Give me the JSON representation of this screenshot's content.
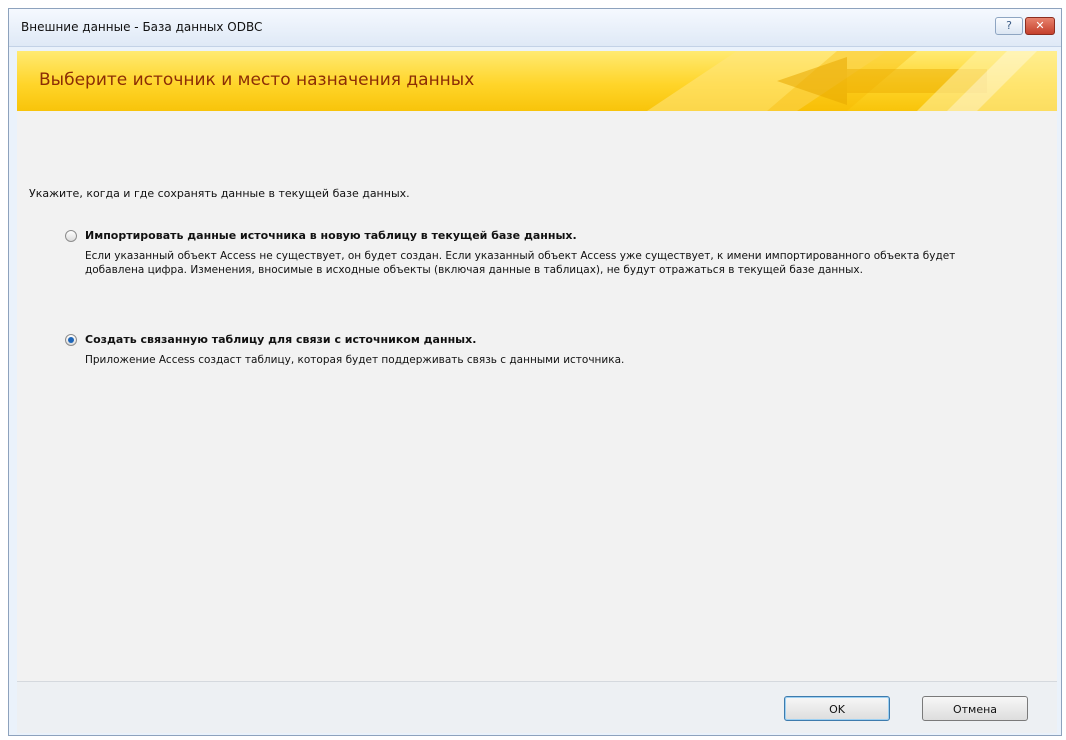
{
  "window": {
    "title": "Внешние данные - База данных ODBC",
    "help_symbol": "?",
    "close_symbol": "✕"
  },
  "banner": {
    "heading": "Выберите источник и место назначения данных",
    "colors": {
      "base": "#ffd52a",
      "heading": "#8c2d05"
    }
  },
  "main": {
    "instruction": "Укажите, когда и где сохранять данные в текущей базе данных.",
    "options": [
      {
        "label": "Импортировать данные источника в новую таблицу в текущей базе данных.",
        "description": "Если указанный объект Access не существует, он будет создан. Если указанный объект Access уже существует, к имени импортированного объекта будет добавлена цифра. Изменения, вносимые в исходные объекты (включая данные в таблицах), не будут отражаться в текущей базе данных.",
        "selected": false
      },
      {
        "label": "Создать связанную таблицу для связи с источником данных.",
        "description": "Приложение Access создаст таблицу, которая будет поддерживать связь с данными источника.",
        "selected": true
      }
    ]
  },
  "footer": {
    "ok_label": "OK",
    "cancel_label": "Отмена"
  }
}
